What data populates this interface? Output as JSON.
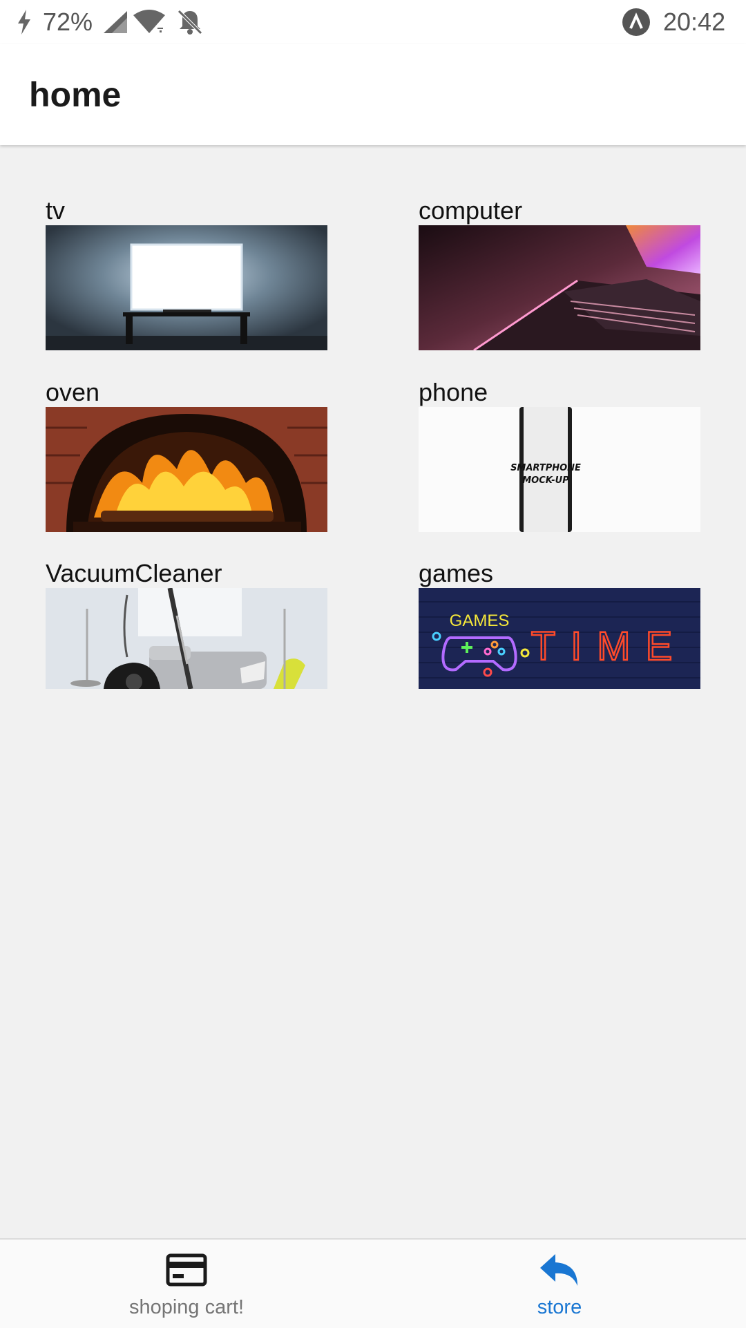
{
  "status_bar": {
    "battery_level": "72%",
    "time": "20:42",
    "icons": [
      "charging-bolt-icon",
      "cell-signal-icon",
      "wifi-icon",
      "notifications-muted-icon",
      "app-notification-icon"
    ]
  },
  "app_bar": {
    "title": "home"
  },
  "categories": [
    {
      "label": "tv",
      "image": "tv-photo"
    },
    {
      "label": "computer",
      "image": "laptop-photo"
    },
    {
      "label": "oven",
      "image": "wood-fired-oven-photo"
    },
    {
      "label": "phone",
      "image": "smartphone-mockup-photo",
      "image_text": [
        "SMARTPHONE",
        "MOCK-UP"
      ]
    },
    {
      "label": "VacuumCleaner",
      "image": "vacuum-cleaner-photo"
    },
    {
      "label": "games",
      "image": "games-neon-sign-photo",
      "image_text": [
        "GAMES",
        "TIME"
      ]
    }
  ],
  "bottom_nav": {
    "items": [
      {
        "label": "shoping cart!",
        "icon": "credit-card-icon",
        "active": false
      },
      {
        "label": "store",
        "icon": "reply-arrow-icon",
        "active": true
      }
    ],
    "active_color": "#1976d2",
    "inactive_color": "#757575"
  },
  "colors": {
    "background": "#f1f1f1",
    "app_bar": "#ffffff",
    "accent": "#1976d2"
  }
}
